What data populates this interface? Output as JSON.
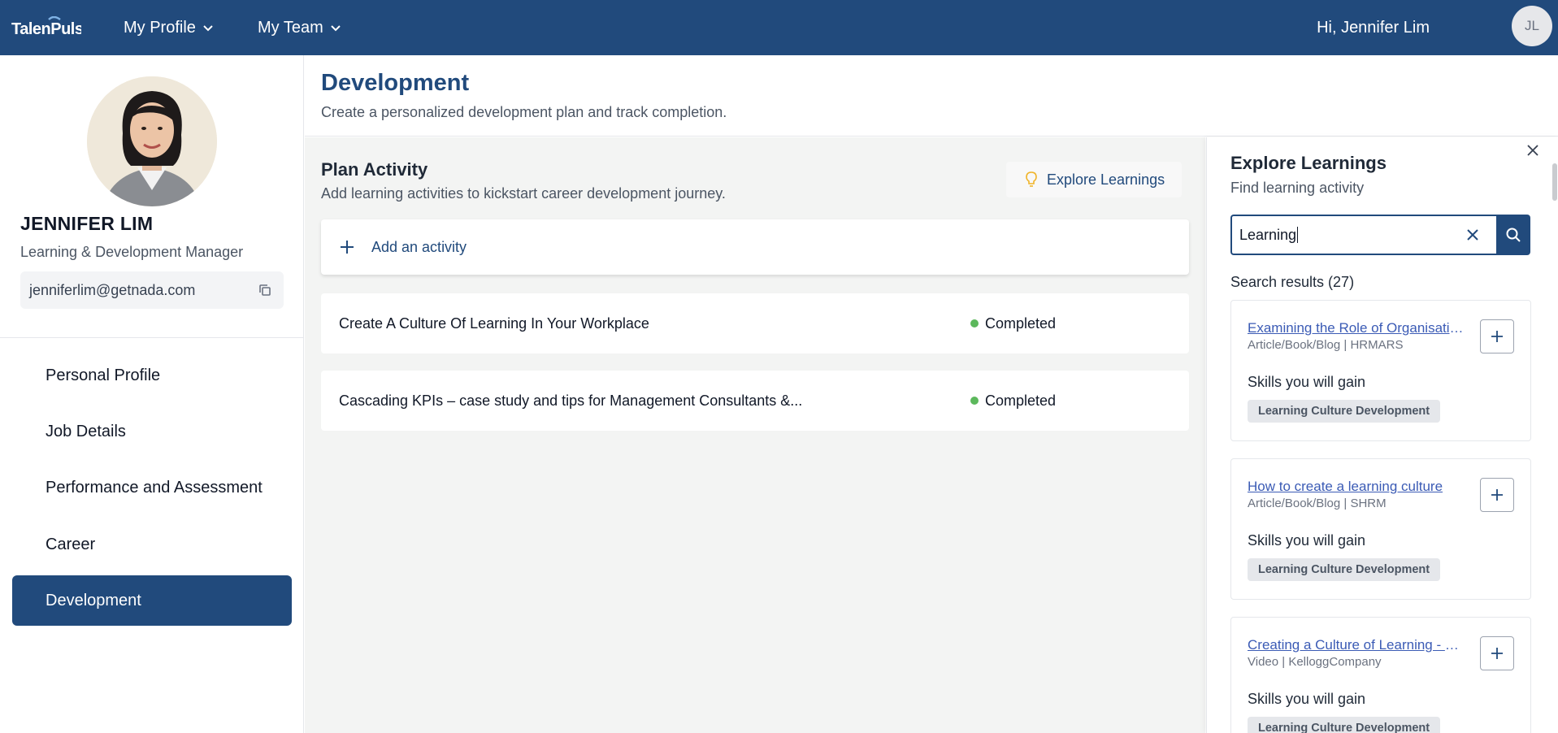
{
  "app": {
    "logo_text": "TalenPulse",
    "brand_color": "#214a7c"
  },
  "topbar": {
    "nav": [
      {
        "label": "My Profile",
        "icon": "chevron-down-icon"
      },
      {
        "label": "My Team",
        "icon": "chevron-down-icon"
      }
    ],
    "greeting": "Hi, Jennifer Lim",
    "avatar_initials": "JL"
  },
  "sidebar": {
    "name": "JENNIFER LIM",
    "role": "Learning & Development Manager",
    "email": "jenniferlim@getnada.com",
    "items": [
      {
        "label": "Personal Profile",
        "active": false
      },
      {
        "label": "Job Details",
        "active": false
      },
      {
        "label": "Performance and Assessment",
        "active": false
      },
      {
        "label": "Career",
        "active": false
      },
      {
        "label": "Development",
        "active": true
      }
    ]
  },
  "header": {
    "title": "Development",
    "subtitle": "Create a personalized development plan and track completion."
  },
  "plan": {
    "title": "Plan Activity",
    "subtitle": "Add learning activities to kickstart career development journey.",
    "explore_button": "Explore Learnings",
    "add_activity": "Add an activity",
    "activities": [
      {
        "title": "Create A Culture Of Learning In Your Workplace",
        "status": "Completed"
      },
      {
        "title": "Cascading KPIs – case study and tips for Management Consultants &...",
        "status": "Completed"
      }
    ],
    "status_color": "#5cb85c"
  },
  "explore": {
    "title": "Explore Learnings",
    "subtitle": "Find learning activity",
    "search_value": "Learning",
    "results_label": "Search results (27)",
    "results": [
      {
        "title": "Examining the Role of Organisational Learning Culture",
        "meta": "Article/Book/Blog | HRMARS",
        "skills_label": "Skills you will gain",
        "skill": "Learning Culture Development"
      },
      {
        "title": "How to create a learning culture",
        "meta": "Article/Book/Blog | SHRM",
        "skills_label": "Skills you will gain",
        "skill": "Learning Culture Development"
      },
      {
        "title": "Creating a Culture of Learning - Kellogg",
        "meta": "Video | KelloggCompany",
        "skills_label": "Skills you will gain",
        "skill": "Learning Culture Development"
      }
    ]
  }
}
